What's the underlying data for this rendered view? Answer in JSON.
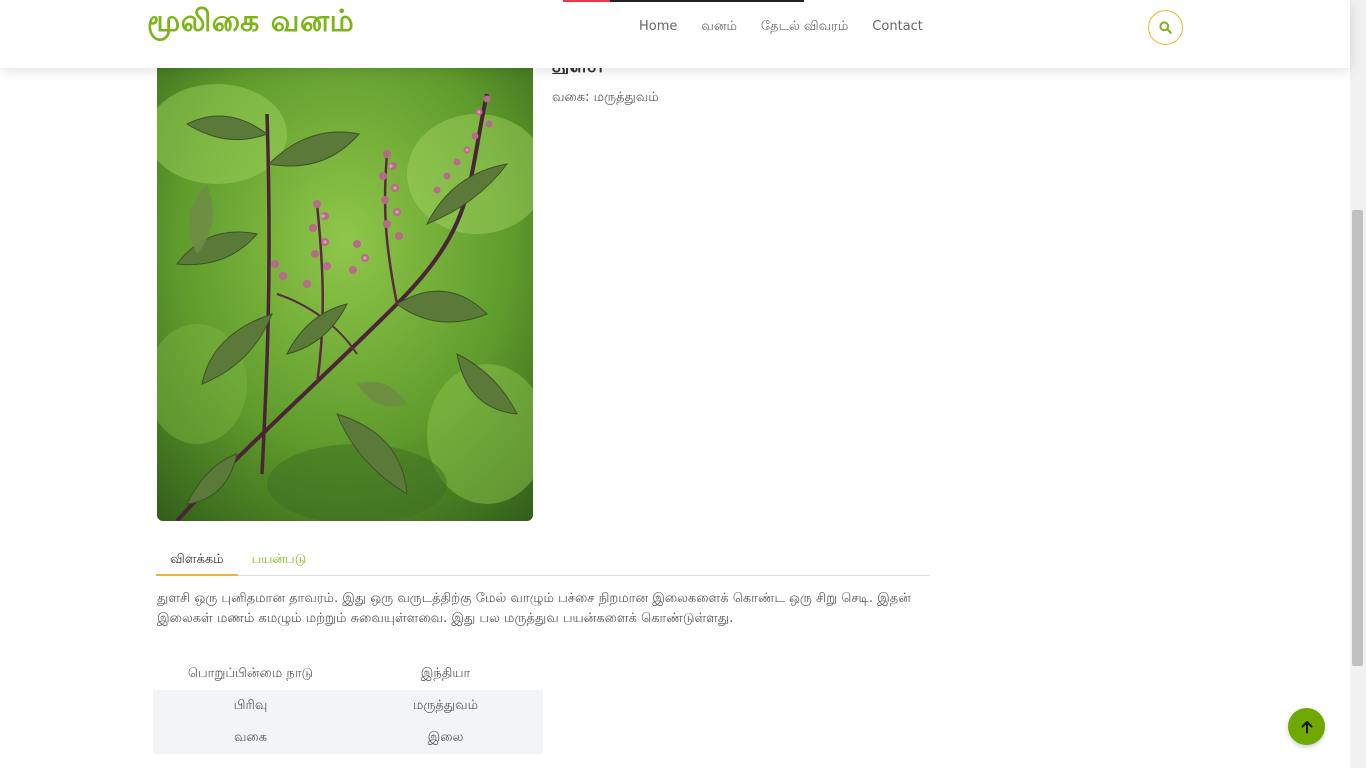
{
  "site": {
    "brand": "மூலிகை வனம்",
    "nav": [
      "Home",
      "வனம்",
      "தேடல் விவரம்",
      "Contact"
    ],
    "accent_color": "#7cb518",
    "search_icon": "search-icon"
  },
  "plant": {
    "title": "துளசி",
    "type_line": "வகை: மருத்துவம்",
    "image_alt": "Tulsi plant photo"
  },
  "tabs": [
    "விளக்கம்",
    "பயன்படு"
  ],
  "description": "துளசி ஒரு புனிதமான தாவரம். இது ஒரு வருடத்திற்கு மேல் வாழும் பச்சை நிறமான இலைகளைக் கொண்ட ஒரு சிறு செடி. இதன் இலைகள் மணம் கமழும் மற்றும் சுவையுள்ளவை. இது பல மருத்துவ பயன்களைக் கொண்டுள்ளது.",
  "info_table": [
    [
      "பொறுப்பின்மை நாடு",
      "இந்தியா"
    ],
    [
      "பிரிவு",
      "மருத்துவம்"
    ],
    [
      "வகை",
      "இலை"
    ]
  ],
  "back_to_top_icon": "arrow-up-icon"
}
